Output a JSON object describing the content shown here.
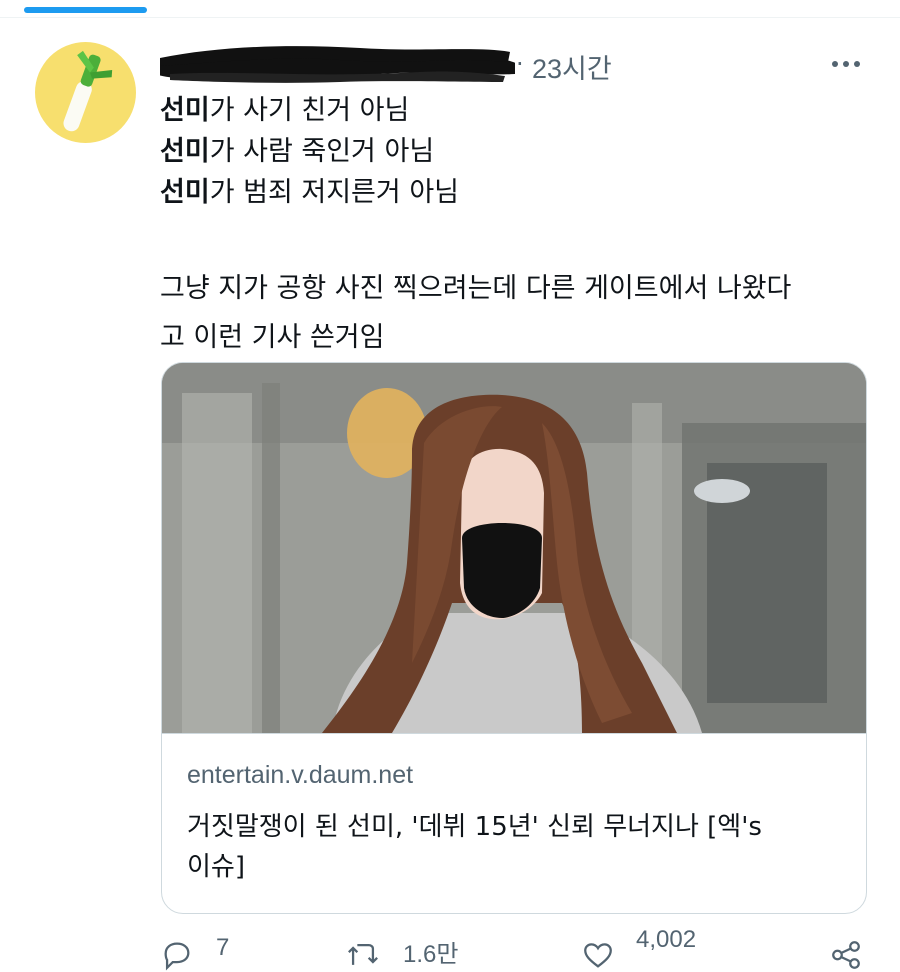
{
  "tweet": {
    "time": "23시간",
    "separator": "·",
    "lines": [
      {
        "bold": "선미",
        "rest": "가 사기 친거 아님"
      },
      {
        "bold": "선미",
        "rest": "가 사람 죽인거 아님"
      },
      {
        "bold": "선미",
        "rest": "가 범죄 저지른거 아님"
      }
    ],
    "paragraph2": [
      "그냥 지가 공항 사진 찍으려는데 다른 게이트에서 나왔다",
      "고 이런 기사 쓴거임"
    ]
  },
  "card": {
    "domain": "entertain.v.daum.net",
    "title_line1": "거짓말쟁이 된 선미, '데뷔 15년' 신뢰 무너지나 [엑's",
    "title_line2": "이슈]"
  },
  "actions": {
    "reply_count": "7",
    "retweet_count": "1.6만",
    "like_count": "4,002"
  },
  "icons": {
    "more": "more-horizontal-icon",
    "reply": "reply-icon",
    "retweet": "retweet-icon",
    "like": "heart-icon",
    "share": "share-icon"
  },
  "colors": {
    "accent": "#1d9bf0",
    "secondary_text": "#536471",
    "avatar_bg": "#f7df6e"
  }
}
